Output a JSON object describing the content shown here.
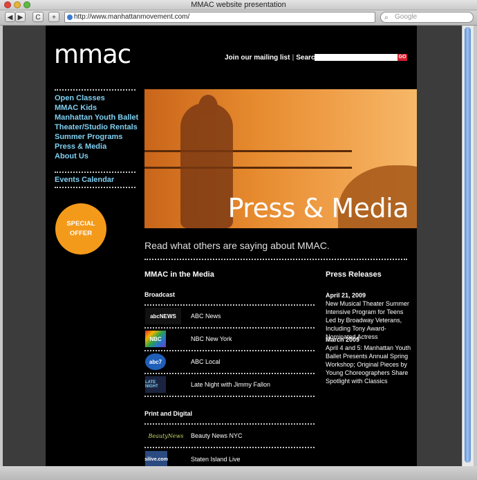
{
  "window": {
    "title": "MMAC website presentation"
  },
  "toolbar": {
    "url": "http://www.manhattanmovement.com/",
    "search_placeholder": "Google",
    "back_label": "◀",
    "forward_label": "▶",
    "reload_label": "C",
    "add_label": "+"
  },
  "site": {
    "logo_text": "mmac",
    "mailing_label": "Join our mailing list",
    "search_label": "Search:",
    "go_label": "GO"
  },
  "nav": {
    "items": [
      "Open Classes",
      "MMAC Kids",
      "Manhattan Youth Ballet",
      "Theater/Studio Rentals",
      "Summer Programs",
      "Press & Media",
      "About Us"
    ],
    "calendar": "Events Calendar",
    "special_line1": "SPECIAL",
    "special_line2": "OFFER"
  },
  "hero": {
    "title": "Press & Media"
  },
  "main": {
    "tagline": "Read what others are saying about MMAC.",
    "media_heading": "MMAC in the Media",
    "broadcast_heading": "Broadcast",
    "print_heading": "Print and Digital",
    "press_heading": "Press Releases"
  },
  "broadcast": [
    {
      "logo": "abcNEWS",
      "name": "ABC News"
    },
    {
      "logo": "NBC",
      "name": "NBC New York"
    },
    {
      "logo": "abc7",
      "name": "ABC Local"
    },
    {
      "logo": "LATE NIGHT",
      "name": "Late Night with Jimmy Fallon"
    }
  ],
  "print": [
    {
      "logo": "BeautyNews",
      "name": "Beauty News NYC"
    },
    {
      "logo": "silive.com",
      "name": "Staten Island Live"
    }
  ],
  "press_releases": [
    {
      "date": "April 21, 2009",
      "text": "New Musical Theater Summer Intensive Program for Teens Led by Broadway Veterans, Including Tony Award-Nominated Actress"
    },
    {
      "date": "March 2009",
      "text": "April 4 and 5: Manhattan Youth Ballet Presents Annual Spring Workshop; Original Pieces by Young Choreographers Share Spotlight with Classics"
    }
  ],
  "colors": {
    "accent": "#7fd0f2",
    "special": "#f49a1a",
    "go": "#d41f2c"
  }
}
